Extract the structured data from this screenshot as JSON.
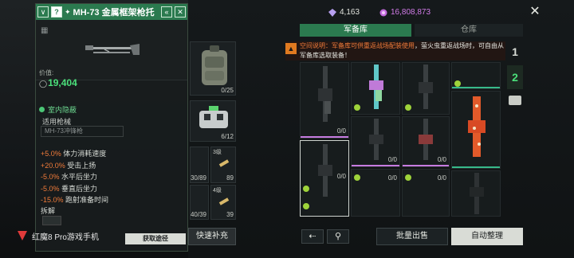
{
  "detail": {
    "title": "MH-73 金属框架枪托",
    "level_badge": "?",
    "price_label": "价值:",
    "price_value": "19,404",
    "tag": "室内隐蔽",
    "compat_label": "适用枪械",
    "compat_value": "MH-73冲锋枪",
    "stats": [
      {
        "value": "+5.0%",
        "name": "体力消耗速度"
      },
      {
        "value": "+20.0%",
        "name": "受击上扬"
      },
      {
        "value": "-5.0%",
        "name": "水平后坐力"
      },
      {
        "value": "-5.0%",
        "name": "垂直后坐力"
      },
      {
        "value": "-15.0%",
        "name": "跑射准备时间"
      }
    ],
    "disassemble_label": "拆解",
    "source_button": "获取途径"
  },
  "backpack": {
    "slots": [
      {
        "count": "0/25"
      },
      {
        "count": "6/12"
      },
      {
        "count": "30/89",
        "level": ""
      },
      {
        "count": "89",
        "level": "3级"
      },
      {
        "count": "40/39",
        "level": ""
      },
      {
        "count": "39",
        "level": "4级"
      }
    ],
    "quick_fill": "快速补充"
  },
  "currency": {
    "gems": "4,163",
    "coins": "16,808,873"
  },
  "tabs": {
    "armory": "军备库",
    "warehouse": "仓库"
  },
  "notice": {
    "prefix": "空间说明：",
    "highlight": "军备库可供重返战场配装使用",
    "rest": "，萤火虫重返战场时，可自由从军备库选取装备！"
  },
  "armory": {
    "cells": [
      {
        "count": "0/0"
      },
      {
        "count": "0/0"
      },
      {
        "count": "0/0"
      },
      {
        "count": "0/0"
      },
      {
        "count": "0/0"
      },
      {
        "count": "0/0"
      },
      {
        "count": "0/0"
      },
      {
        "count": "0/0"
      }
    ]
  },
  "side": {
    "page1": "1",
    "page2": "2"
  },
  "bottom": {
    "bulk_sell": "批量出售",
    "auto_sort": "自动整理"
  },
  "watermark": {
    "text": "红魔8 Pro游戏手机"
  },
  "colors": {
    "accent_green": "#2b7a4f",
    "price_green": "#4be07b",
    "stat_orange": "#f07b3a",
    "coin_purple": "#d27be8"
  }
}
